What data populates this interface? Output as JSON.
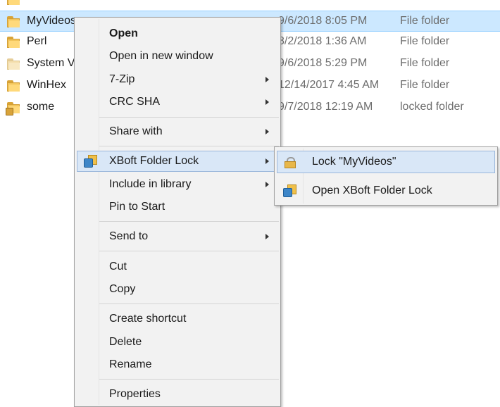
{
  "files": [
    {
      "name": "MyVideos",
      "date": "9/6/2018 8:05 PM",
      "type": "File folder",
      "selected": true,
      "icon": "folder-icon"
    },
    {
      "name": "Perl",
      "date": "8/2/2018 1:36 AM",
      "type": "File folder",
      "selected": false,
      "icon": "folder-icon"
    },
    {
      "name": "System Volume Information",
      "date": "9/6/2018 5:29 PM",
      "type": "File folder",
      "selected": false,
      "icon": "folder-icon"
    },
    {
      "name": "WinHex",
      "date": "12/14/2017 4:45 AM",
      "type": "File folder",
      "selected": false,
      "icon": "folder-icon"
    },
    {
      "name": "some",
      "date": "9/7/2018 12:19 AM",
      "type": "locked folder",
      "selected": false,
      "icon": "locked-folder-icon"
    }
  ],
  "context_menu": {
    "open": "Open",
    "open_new_window": "Open in new window",
    "seven_zip": "7-Zip",
    "crc_sha": "CRC SHA",
    "share_with": "Share with",
    "xboft": "XBoft Folder Lock",
    "include_library": "Include in library",
    "pin_start": "Pin to Start",
    "send_to": "Send to",
    "cut": "Cut",
    "copy": "Copy",
    "create_shortcut": "Create shortcut",
    "delete": "Delete",
    "rename": "Rename",
    "properties": "Properties"
  },
  "submenu": {
    "lock": "Lock \"MyVideos\"",
    "open_xboft": "Open XBoft Folder Lock"
  },
  "colors": {
    "selection": "#cce8ff",
    "menu_hover": "#d9e7f7",
    "menu_bg": "#f2f2f2"
  }
}
